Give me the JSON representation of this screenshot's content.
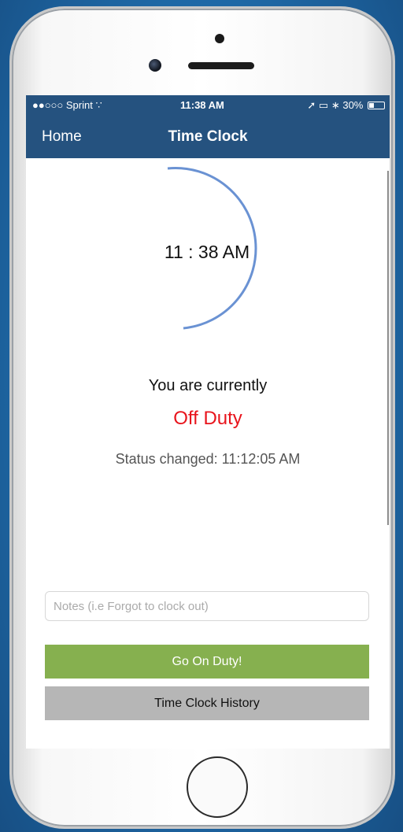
{
  "device": {
    "home_button_icon": "home-button-icon"
  },
  "status_bar": {
    "carrier": "●●○○○ Sprint",
    "wifi_icon": "wifi-icon",
    "time": "11:38 AM",
    "location_icon": "location-arrow-icon",
    "airplay_icon": "airplay-icon",
    "bluetooth_icon": "bluetooth-icon",
    "battery": "30%",
    "battery_level": 0.3
  },
  "nav": {
    "back_label": "Home",
    "title": "Time Clock"
  },
  "clock": {
    "time": "11 : 38 AM",
    "arc_color": "#6a92d3"
  },
  "status": {
    "prefix": "You are currently",
    "value": "Off Duty",
    "value_color": "#e8141c",
    "changed": "Status changed: 11:12:05 AM"
  },
  "form": {
    "notes_placeholder": "Notes (i.e Forgot to clock out)",
    "notes_value": ""
  },
  "buttons": {
    "go_on_duty": "Go On Duty!",
    "history": "Time Clock History"
  },
  "colors": {
    "header": "#25527f",
    "duty_button": "#86b04f",
    "history_button": "#b6b6b6",
    "background": "#1f6aa8"
  }
}
